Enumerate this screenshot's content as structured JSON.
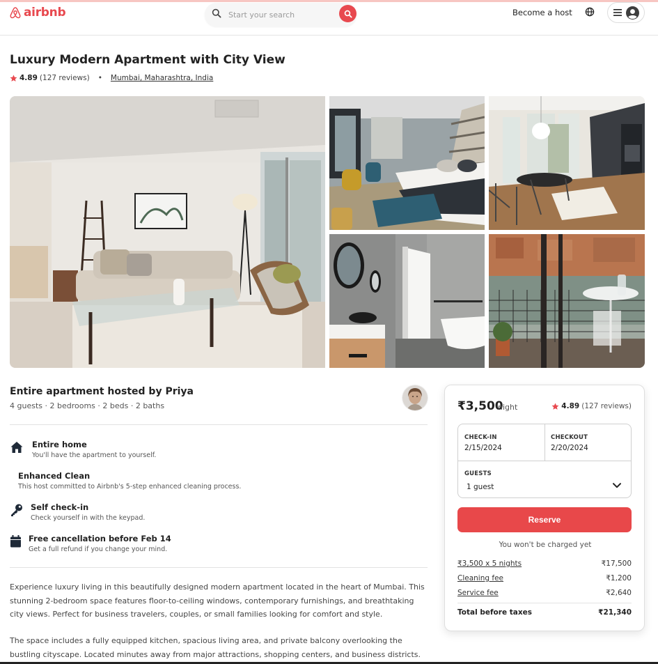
{
  "brand": {
    "name": "airbnb",
    "accent": "#e8494f"
  },
  "header": {
    "search_placeholder": "Start your search",
    "become_host": "Become a host",
    "icons": [
      "search-icon",
      "globe-icon",
      "menu-icon",
      "user-icon"
    ]
  },
  "listing": {
    "title": "Luxury Modern Apartment with City View",
    "rating": "4.89",
    "reviews": "(127 reviews)",
    "location": "Mumbai, Maharashtra, India",
    "photos": [
      "living-room-photo",
      "bedroom-photo",
      "kitchen-dining-photo",
      "bathroom-photo",
      "balcony-photo"
    ]
  },
  "host": {
    "title": "Entire apartment hosted by Priya",
    "stats": "4 guests · 2 bedrooms · 2 beds · 2 baths"
  },
  "features": [
    {
      "title": "Entire home",
      "desc": "You'll have the apartment to yourself.",
      "icon": "home-icon"
    },
    {
      "title": "Enhanced Clean",
      "desc": "This host committed to Airbnb's 5-step enhanced cleaning process.",
      "icon": ""
    },
    {
      "title": "Self check-in",
      "desc": "Check yourself in with the keypad.",
      "icon": "key-icon"
    },
    {
      "title": "Free cancellation before Feb 14",
      "desc": "Get a full refund if you change your mind.",
      "icon": "calendar-icon"
    }
  ],
  "description": [
    "Experience luxury living in this beautifully designed modern apartment located in the heart of Mumbai. This stunning 2-bedroom space features floor-to-ceiling windows, contemporary furnishings, and breathtaking city views. Perfect for business travelers, couples, or small families looking for comfort and style.",
    "The space includes a fully equipped kitchen, spacious living area, and private balcony overlooking the bustling cityscape. Located minutes away from major attractions, shopping centers, and business districts."
  ],
  "booking": {
    "price": "₹3,500",
    "price_unit": "night",
    "rating": "4.89",
    "reviews": "(127 reviews)",
    "checkin_label": "CHECK-IN",
    "checkin_value": "2/15/2024",
    "checkout_label": "CHECKOUT",
    "checkout_value": "2/20/2024",
    "guests_label": "GUESTS",
    "guests_value": "1 guest",
    "reserve_label": "Reserve",
    "no_charge": "You won't be charged yet",
    "fees": [
      {
        "label": "₹3,500 x 5 nights",
        "value": "₹17,500"
      },
      {
        "label": "Cleaning fee",
        "value": "₹1,200"
      },
      {
        "label": "Service fee",
        "value": "₹2,640"
      }
    ],
    "total_label": "Total before taxes",
    "total_value": "₹21,340"
  }
}
